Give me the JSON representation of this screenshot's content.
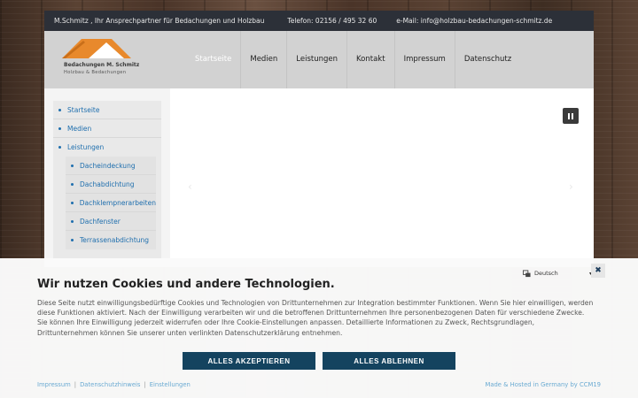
{
  "topbar": {
    "tagline": "M.Schmitz , Ihr Ansprechpartner für Bedachungen und Holzbau",
    "phone": "Telefon: 02156 / 495 32 60",
    "email": "e-Mail: info@holzbau-bedachungen-schmitz.de"
  },
  "logo": {
    "name": "Bedachungen M. Schmitz",
    "subtitle": "Holzbau & Bedachungen",
    "colors": {
      "roof": "#e8892c",
      "roof_light": "#ffffff"
    }
  },
  "nav": {
    "items": [
      {
        "label": "Startseite",
        "active": true
      },
      {
        "label": "Medien"
      },
      {
        "label": "Leistungen"
      },
      {
        "label": "Kontakt"
      },
      {
        "label": "Impressum"
      },
      {
        "label": "Datenschutz"
      }
    ]
  },
  "sidebar": {
    "items": [
      {
        "label": "Startseite"
      },
      {
        "label": "Medien"
      },
      {
        "label": "Leistungen"
      }
    ],
    "subitems": [
      {
        "label": "Dacheindeckung"
      },
      {
        "label": "Dachabdichtung"
      },
      {
        "label": "Dachklempnerarbeiten"
      },
      {
        "label": "Dachfenster"
      },
      {
        "label": "Terrassenabdichtung"
      }
    ]
  },
  "slider": {
    "pause_icon": "pause-icon",
    "arrow_left": "‹",
    "arrow_right": "›"
  },
  "cookie": {
    "language": "Deutsch",
    "title": "Wir nutzen Cookies und andere Technologien.",
    "text": "Diese Seite nutzt einwilligungsbedürftige Cookies und Technologien von Drittunternehmen zur Integration bestimmter Funktionen. Wenn Sie hier einwilligen, werden diese Funktionen aktiviert. Nach der Einwilligung verarbeiten wir und die betroffenen Drittunternehmen Ihre personenbezogenen Daten für verschiedene Zwecke. Sie können Ihre Einwilligung jederzeit widerrufen oder Ihre Cookie-Einstellungen anpassen. Detaillierte Informationen zu Zweck, Rechtsgrundlagen, Drittunternehmen können Sie unserer unten verlinkten Datenschutzerklärung entnehmen.",
    "accept_label": "ALLES AKZEPTIEREN",
    "reject_label": "ALLES ABLEHNEN",
    "links": [
      "Impressum",
      "Datenschutzhinweis",
      "Einstellungen"
    ],
    "hosted": "Made & Hosted in Germany by CCM19",
    "colors": {
      "button": "#14435f",
      "link": "#6aaad2"
    }
  }
}
